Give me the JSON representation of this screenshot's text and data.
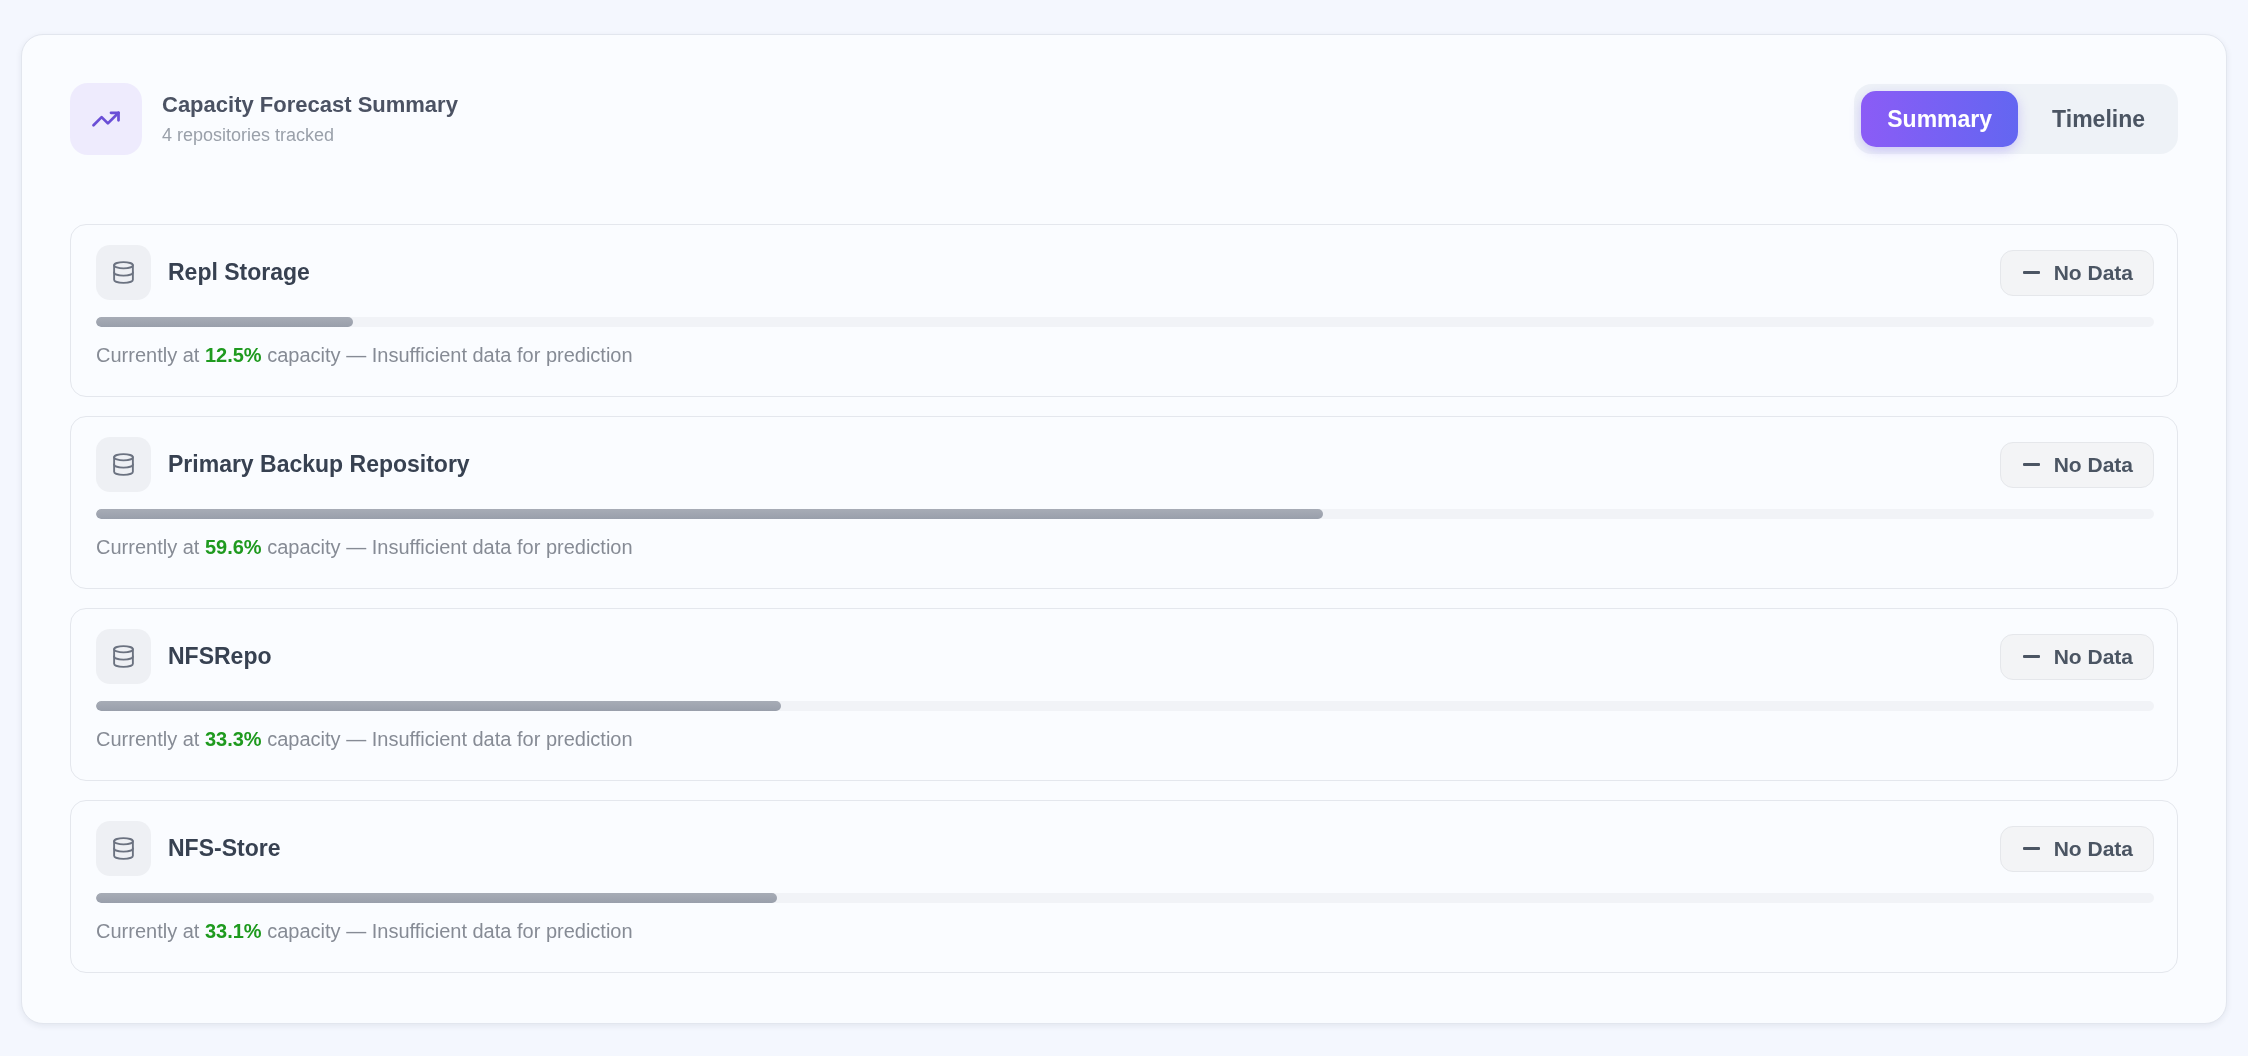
{
  "header": {
    "title": "Capacity Forecast Summary",
    "subtitle": "4 repositories tracked"
  },
  "tabs": [
    {
      "label": "Summary",
      "selected": true
    },
    {
      "label": "Timeline",
      "selected": false
    }
  ],
  "repositories": [
    {
      "name": "Repl Storage",
      "status": {
        "kind": "no-data",
        "label": "No Data"
      },
      "level": 0.125,
      "note": "Currently at **12.5%** capacity — Insufficient data for prediction"
    },
    {
      "name": "Primary Backup Repository",
      "status": {
        "kind": "no-data",
        "label": "No Data"
      },
      "level": 0.596,
      "note": "Currently at **59.6%** capacity — Insufficient data for prediction"
    },
    {
      "name": "NFSRepo",
      "status": {
        "kind": "no-data",
        "label": "No Data"
      },
      "level": 0.333,
      "note": "Currently at **33.3%** capacity — Insufficient data for prediction"
    },
    {
      "name": "NFS-Store",
      "status": {
        "kind": "no-data",
        "label": "No Data"
      },
      "level": 0.331,
      "note": "Currently at **33.1%** capacity — Insufficient data for prediction"
    }
  ]
}
